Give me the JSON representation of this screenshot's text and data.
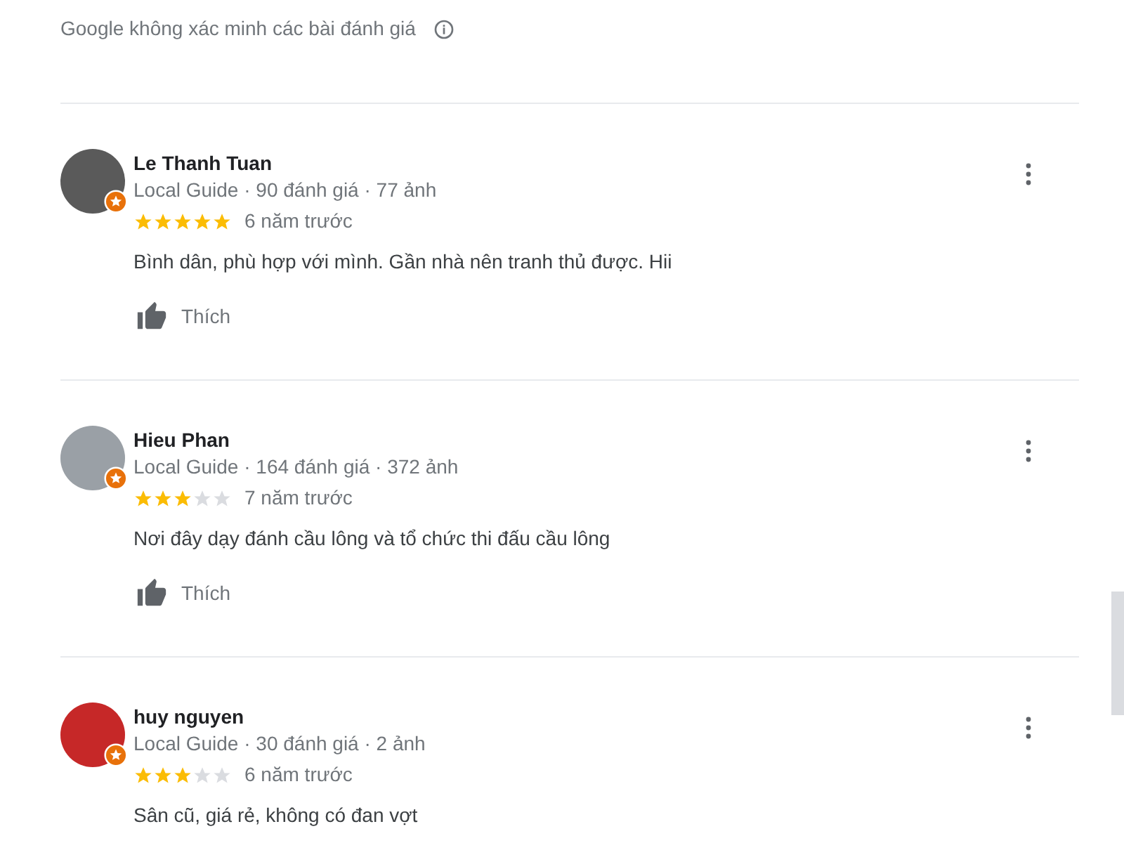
{
  "notice": {
    "text": "Google không xác minh các bài đánh giá"
  },
  "reviews": [
    {
      "name": "Le Thanh Tuan",
      "meta": "Local Guide · 90 đánh giá · 77 ảnh",
      "stars": 5,
      "time": "6 năm trước",
      "text": "Bình dân, phù hợp với mình. Gần nhà nên tranh thủ được. Hii",
      "like": "Thích"
    },
    {
      "name": "Hieu Phan",
      "meta": "Local Guide · 164 đánh giá · 372 ảnh",
      "stars": 3,
      "time": "7 năm trước",
      "text": "Nơi đây dạy đánh cầu lông và tổ chức thi đấu cầu lông",
      "like": "Thích"
    },
    {
      "name": "huy nguyen",
      "meta": "Local Guide · 30 đánh giá · 2 ảnh",
      "stars": 3,
      "time": "6 năm trước",
      "text": "Sân cũ, giá rẻ, không có đan vợt"
    }
  ]
}
